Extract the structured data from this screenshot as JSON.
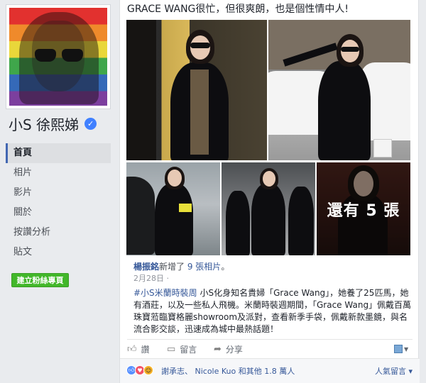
{
  "profile": {
    "name": "小S 徐熙娣",
    "verified": true
  },
  "sidebar": {
    "items": [
      {
        "label": "首頁",
        "active": true
      },
      {
        "label": "相片"
      },
      {
        "label": "影片"
      },
      {
        "label": "關於"
      },
      {
        "label": "按讚分析"
      },
      {
        "label": "貼文"
      }
    ],
    "create_page_label": "建立粉絲專頁"
  },
  "post": {
    "text": "GRACE WANG很忙，但很爽朗，也是個性情中人!",
    "photos_more_label": "還有 5 張",
    "attribution": {
      "author": "楊振銘",
      "action": "新增了",
      "count": "9 張相片",
      "suffix": "。"
    },
    "date": "2月28日 ·",
    "hashtag": "#小S米蘭時裝周",
    "body": " 小S化身知名貴婦「Grace Wang」，她養了25匹馬，她有酒莊，以及一些私人飛機。米蘭時裝週期間，「Grace Wang」佩戴百萬珠寶蒞臨寶格麗showroom及派對，查看新季手袋，佩戴新款墨鏡，與名流合影交談，迅速成為城中最熱話題！",
    "actions": {
      "like": "讚",
      "comment": "留言",
      "share": "分享"
    },
    "reactions": {
      "summary": "謝承志、 Nicole Kuo 和其他 1.8 萬人",
      "sort_label": "人氣留言 ▾"
    }
  },
  "colors": {
    "link": "#365899",
    "create_button": "#42b72a",
    "verified": "#4080ff"
  },
  "icons": [
    "verified-badge-icon",
    "like-thumb-icon",
    "comment-icon",
    "share-icon",
    "audience-photo-icon",
    "love-reaction-icon",
    "haha-reaction-icon"
  ]
}
